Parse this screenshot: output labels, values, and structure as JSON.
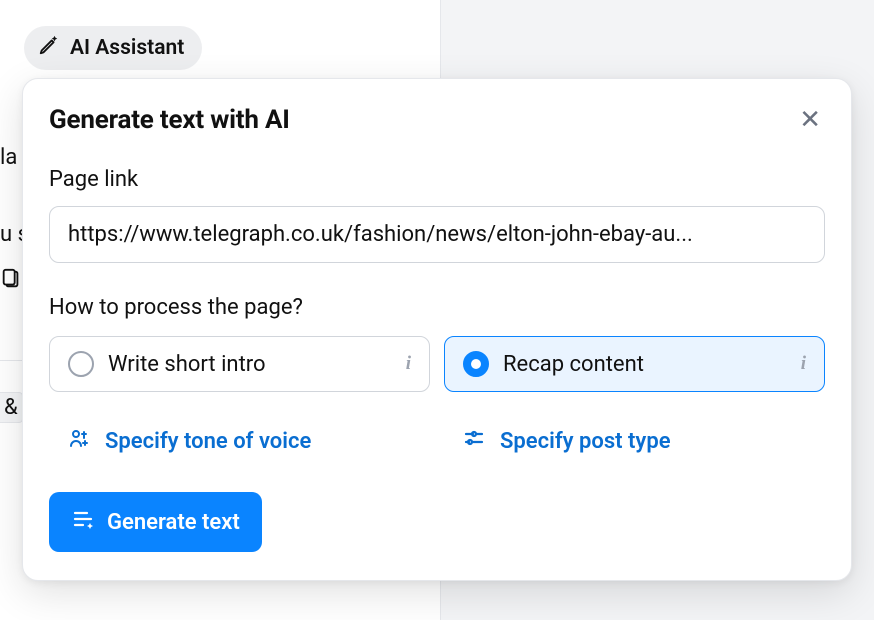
{
  "chip": {
    "label": "AI Assistant"
  },
  "bg": {
    "stub1": "la",
    "stub2": "u s",
    "stub4": "&"
  },
  "modal": {
    "title": "Generate text with AI",
    "page_link_label": "Page link",
    "page_link_value": "https://www.telegraph.co.uk/fashion/news/elton-john-ebay-au...",
    "process_label": "How to process the page?",
    "options": [
      {
        "label": "Write short intro",
        "selected": false
      },
      {
        "label": "Recap content",
        "selected": true
      }
    ],
    "links": [
      {
        "label": "Specify tone of voice"
      },
      {
        "label": "Specify post type"
      }
    ],
    "generate_label": "Generate text"
  }
}
